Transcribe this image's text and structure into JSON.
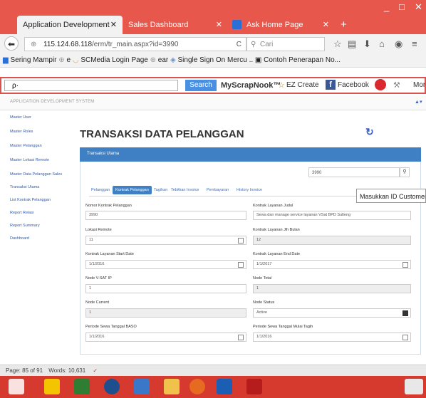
{
  "browser": {
    "tabs": [
      {
        "label": "Application Development",
        "close": "✕"
      },
      {
        "label": "Sales Dashboard",
        "close": "✕"
      },
      {
        "label": "Ask Home Page",
        "close": "✕"
      }
    ],
    "new_tab": "+",
    "window": {
      "minimize": "_",
      "maximize": "□",
      "close": "✕"
    },
    "url_host": "115.124.68.118",
    "url_path": "/erm/tr_main.aspx?id=3990",
    "search_placeholder": "Cari",
    "bookmarks": [
      "Sering Mampir",
      "e",
      "SCMedia Login Page",
      "ear",
      "Single Sign On Mercu ..",
      "Contoh Penerapan No..."
    ],
    "toolbar": {
      "search_prefix": "ρ·",
      "search_button": "Search",
      "items": [
        "MyScrapNook™",
        "EZ Create",
        "Facebook",
        "Mor"
      ]
    }
  },
  "app": {
    "system_name": "APPLICATION DEVELOPMENT SYSTEM",
    "sidebar": [
      "Master User",
      "Master Roles",
      "Master Pelanggan",
      "Master Lokasi Remote",
      "Master Data Pelanggan Sales",
      "Transaksi Utama",
      "List Kontrak Pelanggan",
      "Report Relasi",
      "Report Summary",
      "Dashboard"
    ],
    "page_title": "TRANSAKSI DATA PELANGGAN",
    "panel_title": "Transaksi Utama",
    "id_value": "3990",
    "tooltip": "Masukkan ID Customer At",
    "tabs": [
      "Pelanggan",
      "Kontrak Pelanggan",
      "Tagihan",
      "Tebitkan Invoice",
      "Pembayaran",
      "History Invoice"
    ],
    "fields": {
      "nomor_kontrak": {
        "label": "Nomor Kontrak Pelanggan",
        "value": "3990"
      },
      "kontrak_judul": {
        "label": "Kontrak Layanan Judul",
        "value": "Sewa dan manage service layanan VSat BPD Sulteng"
      },
      "lokasi_remote": {
        "label": "Lokasi Remote",
        "value": "11"
      },
      "kontrak_jlh_bulan": {
        "label": "Kontrak Layanan Jlh Bulan",
        "value": "12"
      },
      "start_date": {
        "label": "Kontrak Layanan Start Date",
        "value": "1/1/2016"
      },
      "end_date": {
        "label": "Kontrak Layanan End Date",
        "value": "1/1/2017"
      },
      "node_v_sat_ip": {
        "label": "Node V-SAT IP",
        "value": "1"
      },
      "node_total": {
        "label": "Node Total",
        "value": "1"
      },
      "node_current": {
        "label": "Node Current",
        "value": "1"
      },
      "node_status": {
        "label": "Node Status",
        "value": "Active"
      },
      "periode_baso": {
        "label": "Periode Sewa Tanggal BASO",
        "value": "1/1/2016"
      },
      "periode_tagih": {
        "label": "Periode Sewa Tanggal Mulai Tagih",
        "value": "1/1/2016"
      }
    }
  },
  "statusbar": {
    "page": "Page: 85 of 91",
    "words": "Words: 10,631"
  },
  "colors": {
    "titlebar": "#e8574b",
    "primary": "#3f7fc3",
    "taskbar": "#d63a2f"
  }
}
